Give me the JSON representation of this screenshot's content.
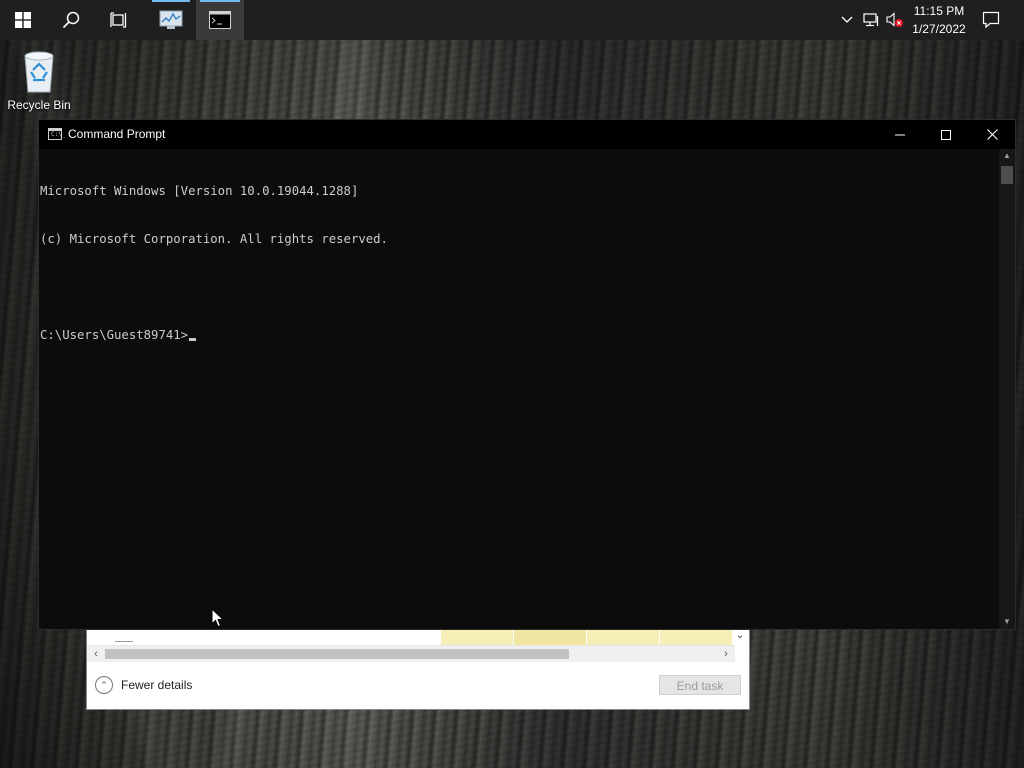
{
  "taskbar": {
    "clock_time": "11:15 PM",
    "clock_date": "1/27/2022",
    "pinned_apps": [
      {
        "name": "task-manager",
        "icon": "task-manager-icon",
        "active": false
      },
      {
        "name": "command-prompt",
        "icon": "command-prompt-icon",
        "active": true
      }
    ]
  },
  "desktop": {
    "icons": [
      {
        "label": "Recycle Bin",
        "icon": "recycle-bin-icon"
      }
    ]
  },
  "command_prompt": {
    "title": "Command Prompt",
    "title_icon_text": "C:\\_",
    "lines": [
      "Microsoft Windows [Version 10.0.19044.1288]",
      "(c) Microsoft Corporation. All rights reserved.",
      "",
      "C:\\Users\\Guest89741>"
    ]
  },
  "task_manager": {
    "fewer_details_label": "Fewer details",
    "end_task_label": "End task"
  },
  "colors": {
    "taskbar": "#1f1f1f",
    "console_bg": "#0c0c0c",
    "console_text": "#cccccc",
    "accent_indicator": "#76b9ed",
    "highlight_cells": "#f7efb8"
  }
}
